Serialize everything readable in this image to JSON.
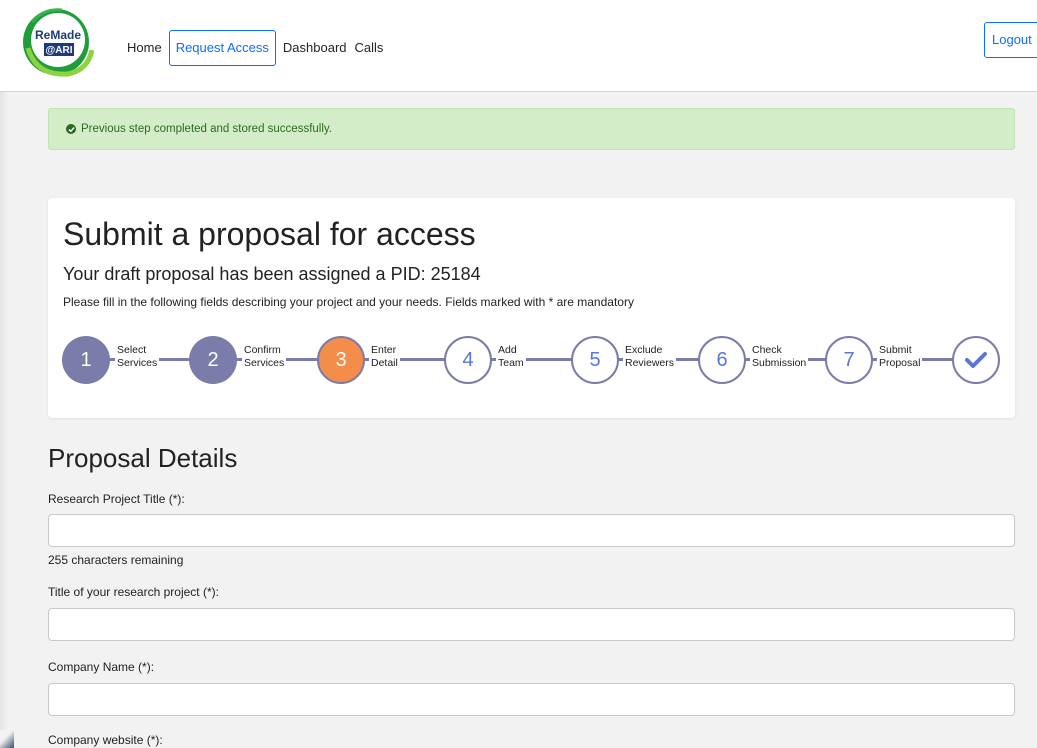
{
  "nav": {
    "logo_line1": "ReMade",
    "logo_line2": "@ARI",
    "links": [
      "Home",
      "Request Access",
      "Dashboard",
      "Calls"
    ],
    "logout": "Logout"
  },
  "alert": {
    "message": "Previous step completed and stored successfully."
  },
  "card": {
    "title": "Submit a proposal for access",
    "subtitle": "Your draft proposal has been assigned a PID: 25184",
    "note": "Please fill in the following fields describing your project and your needs. Fields marked with * are mandatory"
  },
  "steps": [
    {
      "number": "1",
      "line1": "Select",
      "line2": "Services",
      "state": "done"
    },
    {
      "number": "2",
      "line1": "Confirm",
      "line2": "Services",
      "state": "done"
    },
    {
      "number": "3",
      "line1": "Enter",
      "line2": "Detail",
      "state": "current"
    },
    {
      "number": "4",
      "line1": "Add",
      "line2": "Team",
      "state": "todo"
    },
    {
      "number": "5",
      "line1": "Exclude",
      "line2": "Reviewers",
      "state": "todo"
    },
    {
      "number": "6",
      "line1": "Check",
      "line2": "Submission",
      "state": "todo"
    },
    {
      "number": "7",
      "line1": "Submit",
      "line2": "Proposal",
      "state": "todo"
    }
  ],
  "form": {
    "section_title": "Proposal Details",
    "fields": [
      {
        "label": "Research Project Title (*):",
        "value": "",
        "help": "255 characters remaining"
      },
      {
        "label": "Title of your research project (*):",
        "value": ""
      },
      {
        "label": "Company Name (*):",
        "value": ""
      },
      {
        "label": "Company website (*):",
        "value": ""
      }
    ]
  },
  "colors": {
    "step_done": "#7b7ca9",
    "step_current": "#f48c4a",
    "step_todo_text": "#5a77d8",
    "alert_bg": "#d4edc9",
    "alert_text": "#2d6b20",
    "primary": "#0d6efd"
  }
}
